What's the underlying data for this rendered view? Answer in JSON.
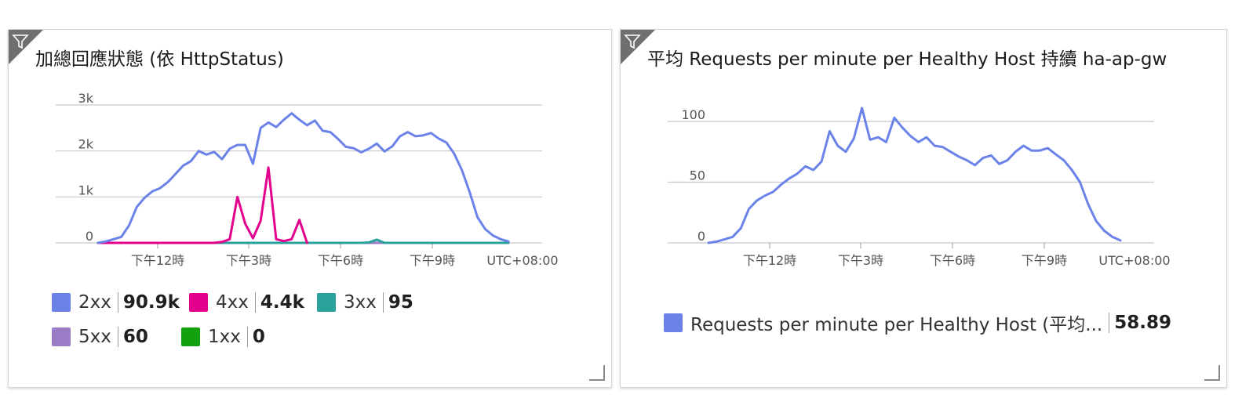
{
  "charts": [
    {
      "title": "加總回應狀態 (依 HttpStatus)",
      "chart_data": {
        "type": "line",
        "title": "加總回應狀態 (依 HttpStatus)",
        "timezone_label": "UTC+08:00",
        "x_tick_labels": [
          "下午12時",
          "下午3時",
          "下午6時",
          "下午9時"
        ],
        "y_tick_labels": [
          "0",
          "1k",
          "2k",
          "3k"
        ],
        "ylim": [
          0,
          3000
        ],
        "grid": true,
        "legend_position": "bottom",
        "series": [
          {
            "name": "2xx",
            "total": "90.9k",
            "color": "#6b83e8",
            "values": [
              0,
              30,
              80,
              130,
              380,
              780,
              980,
              1120,
              1190,
              1320,
              1500,
              1680,
              1780,
              2000,
              1920,
              1980,
              1820,
              2050,
              2130,
              2130,
              1720,
              2500,
              2620,
              2520,
              2680,
              2820,
              2680,
              2560,
              2660,
              2440,
              2410,
              2260,
              2090,
              2060,
              1970,
              2050,
              2160,
              1990,
              2100,
              2320,
              2410,
              2320,
              2340,
              2390,
              2270,
              2180,
              1940,
              1580,
              1100,
              560,
              300,
              160,
              80,
              30
            ]
          },
          {
            "name": "4xx",
            "total": "4.4k",
            "color": "#e3008c",
            "values": [
              0,
              0,
              0,
              0,
              0,
              0,
              0,
              0,
              0,
              0,
              0,
              0,
              0,
              0,
              0,
              0,
              20,
              80,
              1000,
              420,
              100,
              480,
              1640,
              80,
              40,
              80,
              500,
              0,
              null,
              null,
              null,
              null,
              null,
              null,
              null,
              null,
              null,
              null,
              null,
              null,
              null,
              null,
              null,
              null,
              null,
              null,
              null,
              null,
              null,
              null,
              null,
              null,
              null,
              null
            ]
          },
          {
            "name": "3xx",
            "total": "95",
            "color": "#2aa19b",
            "values": [
              0,
              0,
              0,
              0,
              0,
              0,
              0,
              0,
              0,
              0,
              0,
              0,
              0,
              0,
              0,
              0,
              0,
              0,
              0,
              0,
              0,
              0,
              0,
              0,
              0,
              0,
              0,
              0,
              0,
              0,
              0,
              0,
              0,
              0,
              0,
              10,
              70,
              0,
              0,
              0,
              0,
              0,
              0,
              0,
              0,
              0,
              0,
              0,
              0,
              0,
              0,
              0,
              0,
              0
            ]
          },
          {
            "name": "5xx",
            "total": "60",
            "color": "#9b7bc8",
            "values": [
              0,
              0,
              0,
              0,
              0,
              0,
              0,
              0,
              0,
              0,
              0,
              0,
              0,
              0,
              0,
              0,
              0,
              0,
              0,
              0,
              0,
              0,
              0,
              0,
              0,
              0,
              0,
              0,
              0,
              0,
              0,
              0,
              0,
              0,
              0,
              0,
              0,
              0,
              0,
              0,
              0,
              0,
              0,
              0,
              0,
              0,
              0,
              0,
              0,
              0,
              0,
              0,
              0,
              0
            ]
          },
          {
            "name": "1xx",
            "total": "0",
            "color": "#13a10e",
            "values": [
              0,
              0,
              0,
              0,
              0,
              0,
              0,
              0,
              0,
              0,
              0,
              0,
              0,
              0,
              0,
              0,
              0,
              0,
              0,
              0,
              0,
              0,
              0,
              0,
              0,
              0,
              0,
              0,
              0,
              0,
              0,
              0,
              0,
              0,
              0,
              0,
              0,
              0,
              0,
              0,
              0,
              0,
              0,
              0,
              0,
              0,
              0,
              0,
              0,
              0,
              0,
              0,
              0,
              0
            ]
          }
        ]
      }
    },
    {
      "title": "平均 Requests per minute per Healthy Host 持續 ha-ap-gw",
      "chart_data": {
        "type": "line",
        "title": "平均 Requests per minute per Healthy Host 持續 ha-ap-gw",
        "timezone_label": "UTC+08:00",
        "x_tick_labels": [
          "下午12時",
          "下午3時",
          "下午6時",
          "下午9時"
        ],
        "y_tick_labels": [
          "0",
          "50",
          "100"
        ],
        "ylim": [
          0,
          100
        ],
        "grid": true,
        "legend_position": "bottom",
        "series": [
          {
            "name": "Requests per minute per Healthy Host (平均...",
            "total": "58.89",
            "color": "#6b83e8",
            "values": [
              0,
              1,
              3,
              5,
              12,
              28,
              35,
              39,
              42,
              48,
              53,
              57,
              63,
              60,
              67,
              92,
              80,
              75,
              86,
              111,
              85,
              87,
              83,
              103,
              95,
              88,
              83,
              87,
              80,
              79,
              75,
              71,
              68,
              64,
              70,
              72,
              65,
              68,
              75,
              80,
              76,
              76,
              78,
              73,
              68,
              60,
              50,
              32,
              18,
              10,
              5,
              2
            ]
          }
        ]
      }
    }
  ]
}
